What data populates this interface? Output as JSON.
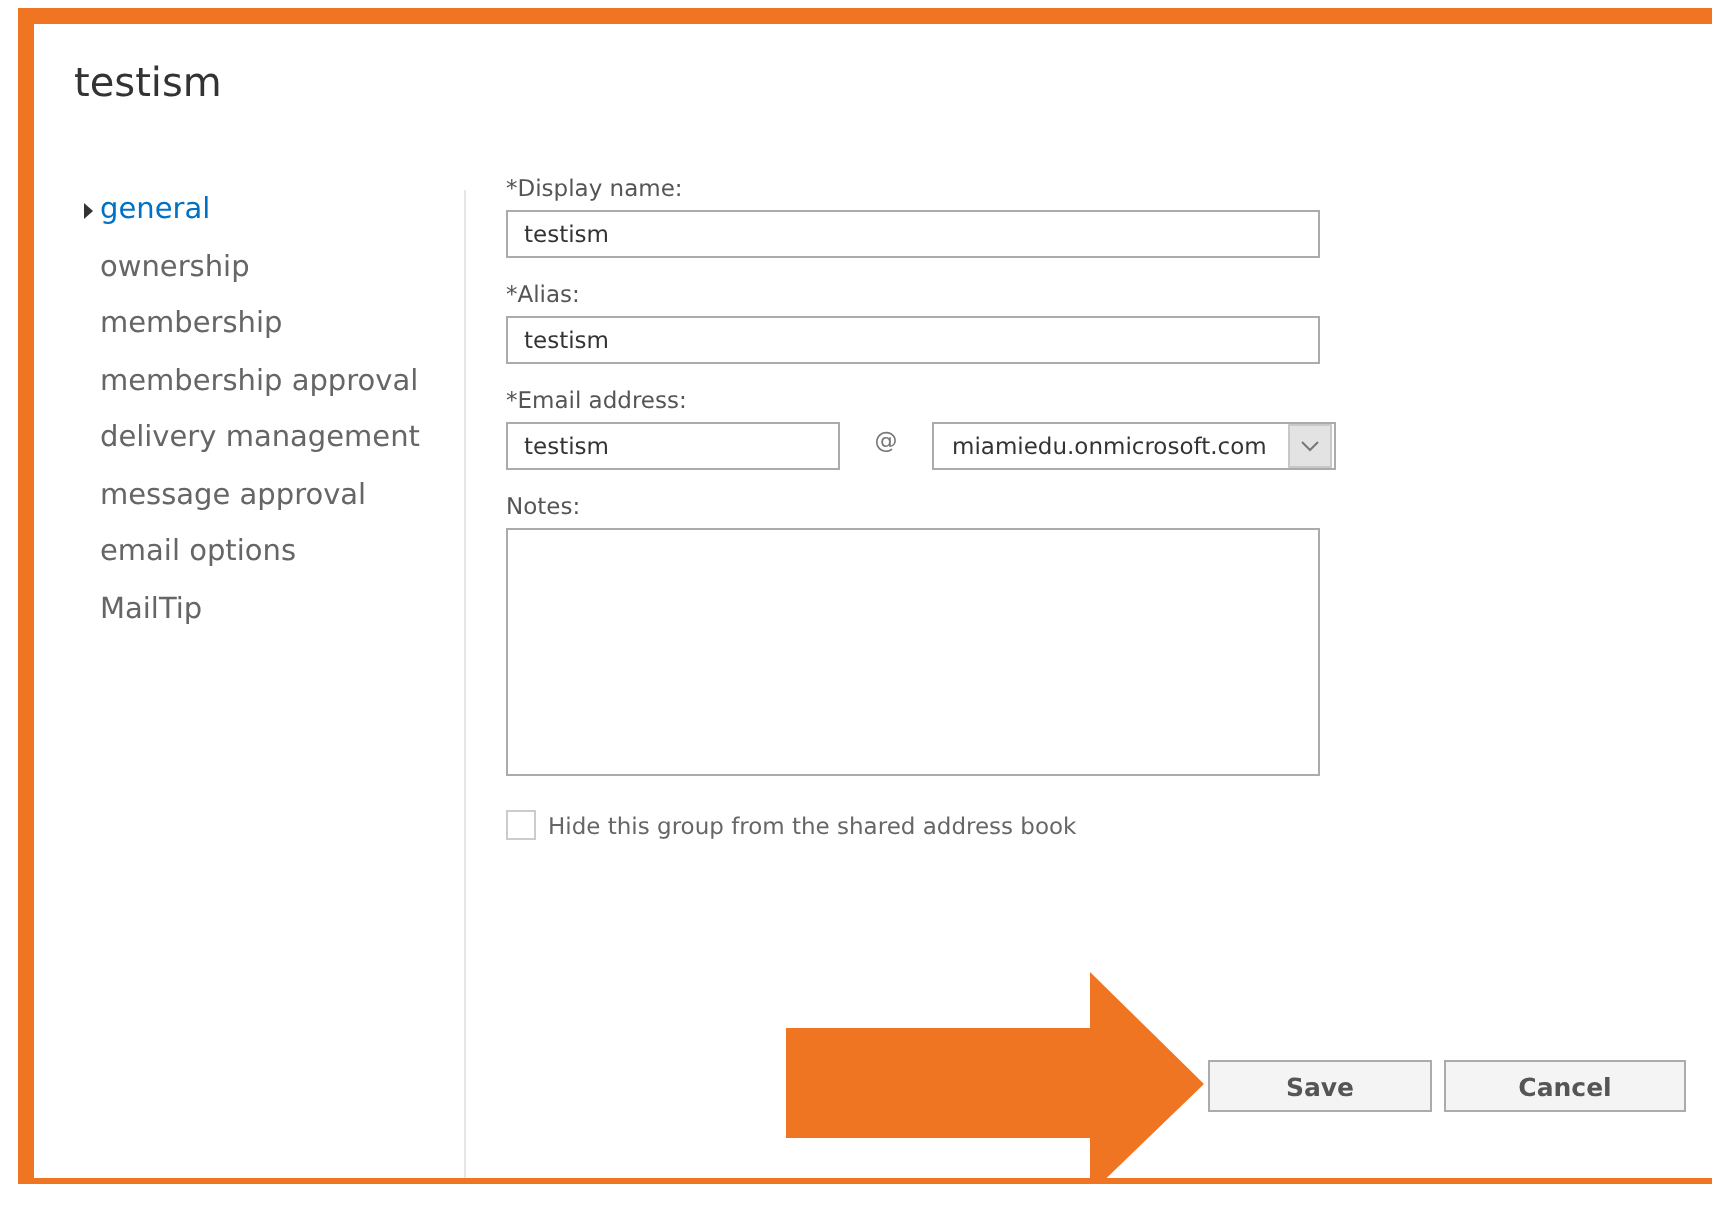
{
  "title": "testism",
  "nav": [
    {
      "label": "general",
      "selected": true
    },
    {
      "label": "ownership",
      "selected": false
    },
    {
      "label": "membership",
      "selected": false
    },
    {
      "label": "membership approval",
      "selected": false
    },
    {
      "label": "delivery management",
      "selected": false
    },
    {
      "label": "message approval",
      "selected": false
    },
    {
      "label": "email options",
      "selected": false
    },
    {
      "label": "MailTip",
      "selected": false
    }
  ],
  "form": {
    "display_name": {
      "label": "*Display name:",
      "value": "testism"
    },
    "alias": {
      "label": "*Alias:",
      "value": "testism"
    },
    "email": {
      "label": "*Email address:",
      "value": "testism",
      "at": "@",
      "domain": "miamiedu.onmicrosoft.com"
    },
    "notes": {
      "label": "Notes:"
    },
    "hide_from_address_book": {
      "label": "Hide this group from the shared address book",
      "checked": false
    }
  },
  "buttons": [
    "Save",
    "Cancel"
  ]
}
